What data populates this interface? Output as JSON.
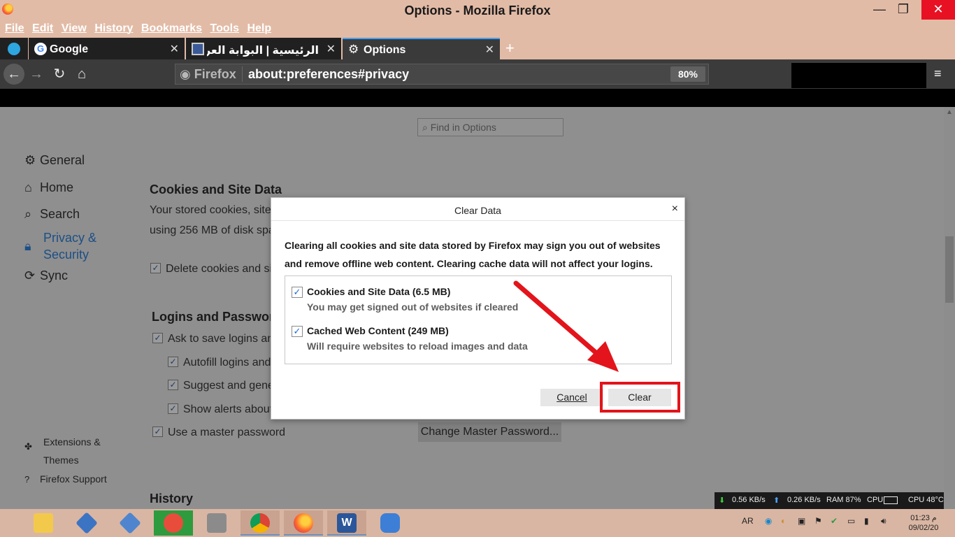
{
  "window": {
    "title": "Options - Mozilla Firefox",
    "controls": {
      "minimize": "—",
      "maximize": "❐",
      "close": "✕"
    }
  },
  "menu": [
    "File",
    "Edit",
    "View",
    "History",
    "Bookmarks",
    "Tools",
    "Help"
  ],
  "tabs": [
    {
      "label": "Google",
      "close": "✕"
    },
    {
      "label": "الرئيسية | البوابة العربية J",
      "close": "✕"
    },
    {
      "label": "Options",
      "close": "✕"
    }
  ],
  "new_tab": "+",
  "navbar": {
    "identity": "Firefox",
    "url": "about:preferences#privacy",
    "zoom": "80%",
    "menu_icon": "≡"
  },
  "preferences": {
    "find_placeholder": "Find in Options",
    "sidebar": [
      {
        "label": "General",
        "icon": "gear-icon"
      },
      {
        "label": "Home",
        "icon": "home-icon"
      },
      {
        "label": "Search",
        "icon": "search-icon"
      },
      {
        "label": "Privacy & Security",
        "icon": "lock-icon"
      },
      {
        "label": "Sync",
        "icon": "sync-icon"
      }
    ],
    "sidebar_bottom": [
      {
        "label": "Extensions & Themes",
        "icon": "puzzle-icon"
      },
      {
        "label": "Firefox Support",
        "icon": "help-icon"
      }
    ],
    "cookies": {
      "heading": "Cookies and Site Data",
      "line1": "Your stored cookies, site",
      "line2": "using 256 MB of disk spa",
      "delete_cb": "Delete cookies and si"
    },
    "logins": {
      "heading": "Logins and Password",
      "ask_save": "Ask to save logins an",
      "autofill": "Autofill logins and",
      "suggest": "Suggest and gene",
      "alerts": "Show alerts about",
      "master": "Use a master password",
      "change_master_btn": "Change Master Password..."
    },
    "history_heading": "History"
  },
  "dialog": {
    "title": "Clear Data",
    "close": "×",
    "message": "Clearing all cookies and site data stored by Firefox may sign you out of websites and remove offline web content. Clearing cache data will not affect your logins.",
    "options": [
      {
        "title": "Cookies and Site Data (6.5 MB)",
        "desc": "You may get signed out of websites if cleared",
        "checked": true
      },
      {
        "title": "Cached Web Content (249 MB)",
        "desc": "Will require websites to reload images and data",
        "checked": true
      }
    ],
    "cancel": "Cancel",
    "clear": "Clear"
  },
  "netmon": {
    "down": "0.56 KB/s",
    "up": "0.26 KB/s",
    "ram": "RAM 87%",
    "cpu": "CPU",
    "cpu_temp": "CPU 48°C"
  },
  "taskbar": {
    "lang": "AR",
    "time": "01:23 م",
    "date": "09/02/20"
  },
  "colors": {
    "highlight": "#e3141b",
    "accent": "#45a1ff",
    "checkmark": "#1f6bd1"
  }
}
